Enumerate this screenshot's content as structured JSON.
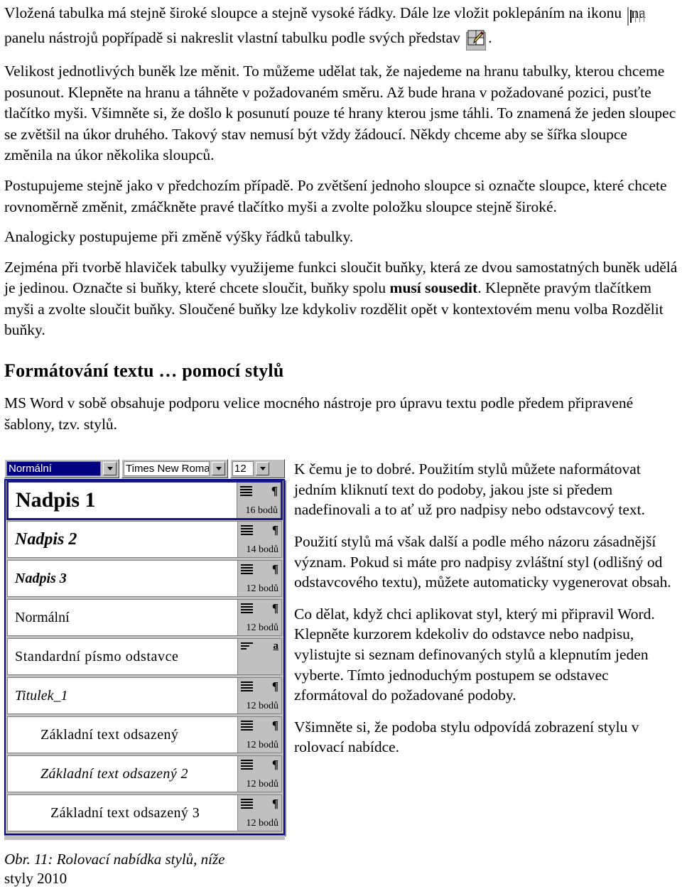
{
  "document": {
    "paragraphs": [
      {
        "id": "p1",
        "part_a": "Vložená tabulka má stejně široké sloupce a stejně vysoké řádky. Dále lze vložit poklepáním na ikonu",
        "icon_1": "insert-table-icon",
        "part_b": "na panelu nástrojů popřípadě si nakreslit vlastní tabulku podle svých představ",
        "icon_2": "draw-table-icon",
        "part_c": "."
      },
      {
        "id": "p2",
        "text": "Velikost jednotlivých buněk lze měnit. To můžeme udělat tak, že najedeme na hranu tabulky, kterou chceme posunout. Klepněte na hranu a táhněte v požadovaném směru. Až bude hrana v požadované pozici, pusťte tlačítko myši. Všimněte si, že došlo k posunutí pouze té hrany kterou jsme táhli. To znamená že jeden sloupec se zvětšil na úkor druhého. Takový stav nemusí být vždy žádoucí. Někdy chceme aby se šířka sloupce změnila na úkor několika sloupců."
      },
      {
        "id": "p3",
        "text": "Postupujeme stejně jako v předchozím případě. Po zvětšení jednoho sloupce si označte sloupce, které chcete rovnoměrně změnit, zmáčkněte pravé tlačítko myši a zvolte položku sloupce stejně široké."
      },
      {
        "id": "p4",
        "text": "Analogicky postupujeme při změně výšky řádků tabulky."
      },
      {
        "id": "p5",
        "part_a": "Zejména při tvorbě hlaviček tabulky využijeme funkci sloučit buňky, která ze dvou samostatných buněk udělá je jedinou. Označte si buňky, které chcete sloučit, buňky spolu ",
        "bold": "musí sousedit",
        "part_b": ". Klepněte pravým tlačítkem myši a zvolte sloučit buňky. Sloučené buňky lze kdykoliv rozdělit opět v kontextovém menu volba Rozdělit buňky."
      }
    ],
    "heading": "Formátování textu … pomocí stylů",
    "intro": "MS Word v sobě obsahuje podporu velice mocného nástroje pro úpravu textu podle předem připravené šablony, tzv. stylů."
  },
  "figure": {
    "toolbar": {
      "style_value": "Normální",
      "font_value": "Times New Roman",
      "size_value": "12",
      "style_dropdown_icon": "chevron-down-icon",
      "font_dropdown_icon": "chevron-down-icon",
      "size_dropdown_icon": "chevron-down-icon"
    },
    "styles": [
      {
        "name": "Nadpis 1",
        "points": "16 bodů",
        "type": "paragraph",
        "marker": "¶",
        "selected": true
      },
      {
        "name": "Nadpis 2",
        "points": "14 bodů",
        "type": "paragraph",
        "marker": "¶",
        "selected": false
      },
      {
        "name": "Nadpis 3",
        "points": "12 bodů",
        "type": "paragraph",
        "marker": "¶",
        "selected": false
      },
      {
        "name": "Normální",
        "points": "12 bodů",
        "type": "paragraph",
        "marker": "¶",
        "selected": false
      },
      {
        "name": "Standardní písmo odstavce",
        "points": "",
        "type": "character",
        "marker": "a",
        "selected": false
      },
      {
        "name": "Titulek_1",
        "points": "12 bodů",
        "type": "paragraph",
        "marker": "¶",
        "selected": false
      },
      {
        "name": "Základní text odsazený",
        "points": "12 bodů",
        "type": "paragraph",
        "marker": "¶",
        "selected": false
      },
      {
        "name": "Základní text odsazený 2",
        "points": "12 bodů",
        "type": "paragraph",
        "marker": "¶",
        "selected": false
      },
      {
        "name": "Základní text odsazený 3",
        "points": "12 bodů",
        "type": "paragraph",
        "marker": "¶",
        "selected": false
      }
    ],
    "caption_italic": "Obr. 11: Rolovací nabídka stylů, níže",
    "caption_plain": "styly 2010"
  },
  "side_text": {
    "p1": "K čemu je to dobré. Použitím stylů můžete naformátovat jedním kliknutí text do podoby, jakou jste si předem nadefinovali a to ať už pro nadpisy nebo odstavcový text.",
    "p2": "Použití stylů má však další a podle mého názoru zásadnější význam. Pokud si máte pro nadpisy zvláštní styl (odlišný od odstavcového textu), můžete automaticky vygenerovat obsah.",
    "p3": "Co dělat, když chci aplikovat styl, který mi připravil Word. Klepněte kurzorem kdekoliv do odstavce nebo nadpisu, vylistujte si seznam definovaných stylů a klepnutím jeden vyberte. Tímto jednoduchým postupem se odstavec zformátoval do požadované podoby.",
    "p4": "Všimněte si, že podoba stylu odpovídá zobrazení stylu v rolovací nabídce."
  },
  "colors": {
    "selection_blue": "#000080",
    "list_border": "#000080",
    "chrome_gray": "#c0c0c0"
  }
}
